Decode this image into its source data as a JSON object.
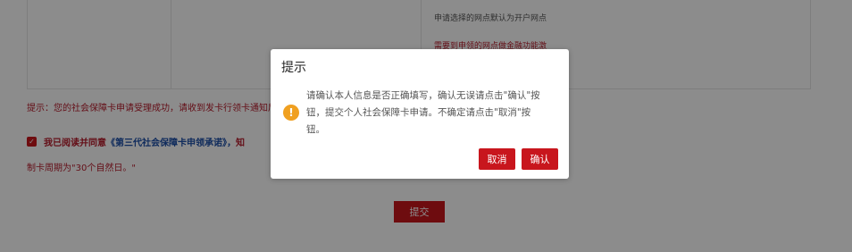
{
  "background": {
    "table_note": "申请选择的网点默认为开户网点",
    "table_warning": "需要到申领的网点做金融功能激",
    "tip": "提示：您的社会保障卡申请受理成功，请收到发卡行领卡通知后前往申领网点领取。",
    "agree_prefix": "我已阅读并同意",
    "agree_link": "《第三代社会保障卡申领承诺》，",
    "agree_suffix": "知",
    "agree_check": "✓",
    "cycle": "制卡周期为\"30个自然日。\"",
    "submit_label": "提交"
  },
  "dialog": {
    "title": "提示",
    "icon": "exclamation-icon",
    "icon_glyph": "!",
    "message": "请确认本人信息是否正确填写，确认无误请点击\"确认\"按钮，提交个人社会保障卡申请。不确定请点击\"取消\"按钮。",
    "cancel_label": "取消",
    "confirm_label": "确认"
  },
  "colors": {
    "brand_red": "#c8161d",
    "warning_orange": "#f0a020",
    "link_blue": "#1d4fa8"
  }
}
